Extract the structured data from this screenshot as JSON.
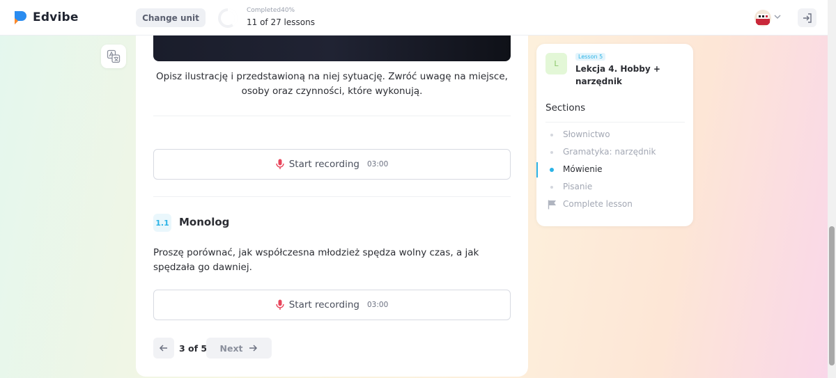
{
  "header": {
    "logo_text": "Edvibe",
    "change_unit_label": "Change unit",
    "progress_label": "Completed40%",
    "progress_percent": 40,
    "lessons_progress": "11 of 27 lessons"
  },
  "main": {
    "image_description_prompt": "Opisz ilustrację i przedstawioną na niej sytuację. Zwróć uwagę na miejsce, osoby oraz czynności, które wykonują.",
    "recording_1": {
      "label": "Start recording",
      "time": "03:00"
    },
    "task": {
      "number": "1.1",
      "title": "Monolog",
      "text": "Proszę porównać, jak współczesna młodzież spędza wolny czas, a jak spędzała go dawniej."
    },
    "recording_2": {
      "label": "Start recording",
      "time": "03:00"
    },
    "pager": {
      "count": "3 of 5",
      "next_label": "Next"
    }
  },
  "sidebar": {
    "lesson_badge": "L",
    "lesson_tag": "Lesson 5",
    "lesson_title": "Lekcja 4. Hobby + narzędnik",
    "sections_title": "Sections",
    "items": [
      {
        "label": "Słownictwo",
        "active": false
      },
      {
        "label": "Gramatyka: narzędnik",
        "active": false
      },
      {
        "label": "Mówienie",
        "active": true
      },
      {
        "label": "Pisanie",
        "active": false
      },
      {
        "label": "Complete lesson",
        "active": false
      }
    ]
  },
  "colors": {
    "accent": "#2bb3e6",
    "mic": "#e8455b",
    "lesson_badge_bg": "#e3f7d7"
  },
  "icons": [
    "translate-icon",
    "mic-icon",
    "arrow-left-icon",
    "arrow-right-icon",
    "flag-icon",
    "logout-icon",
    "chevron-down-icon"
  ]
}
